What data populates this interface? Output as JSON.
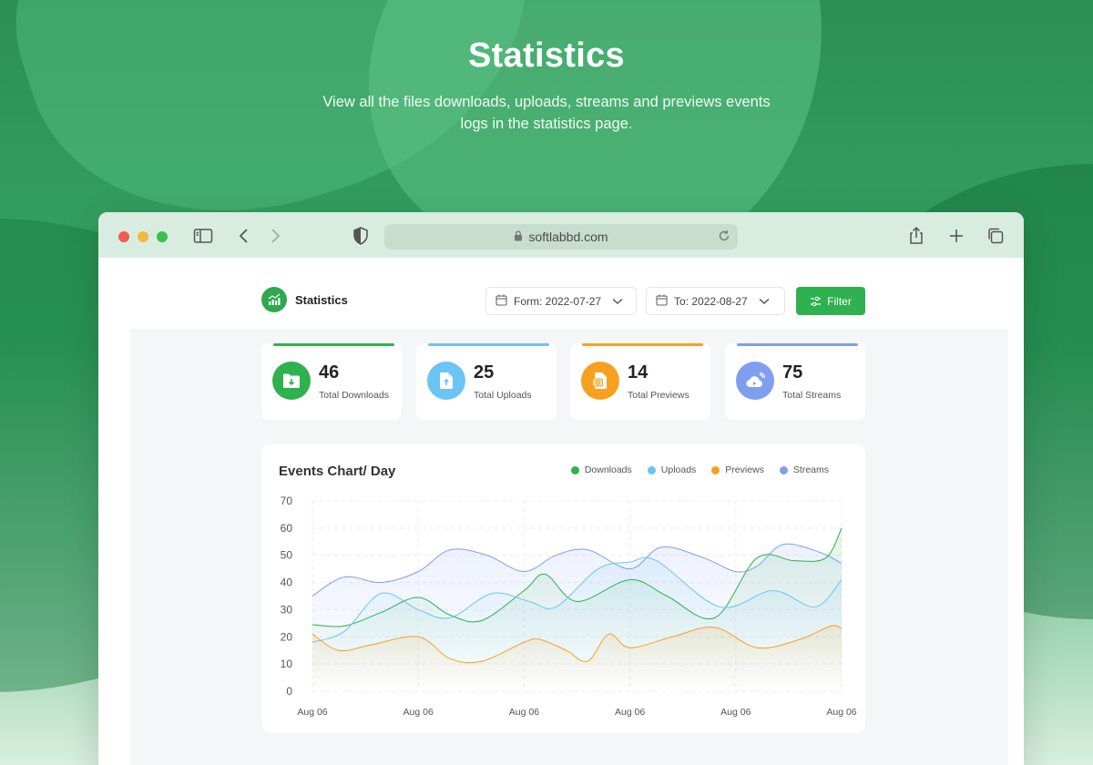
{
  "hero": {
    "title": "Statistics",
    "subtitle": "View all the files downloads, uploads, streams and previews events logs in the statistics page."
  },
  "browser": {
    "url": "softlabbd.com"
  },
  "header": {
    "title": "Statistics",
    "from_date": "Form: 2022-07-27",
    "to_date": "To: 2022-08-27",
    "filter_label": "Filter"
  },
  "stats": [
    {
      "value": "46",
      "label": "Total Downloads",
      "color": "#2fb14f",
      "icon": "folder-download-icon"
    },
    {
      "value": "25",
      "label": "Total Uploads",
      "color": "#6cc3f5",
      "icon": "file-upload-icon"
    },
    {
      "value": "14",
      "label": "Total Previews",
      "color": "#f5a11f",
      "icon": "file-preview-icon"
    },
    {
      "value": "75",
      "label": "Total Streams",
      "color": "#7f9ef0",
      "icon": "cloud-stream-icon"
    }
  ],
  "chart_data": {
    "type": "area",
    "title": "Events Chart/ Day",
    "x": [
      "Aug 06",
      "Aug 06",
      "Aug 06",
      "Aug 06",
      "Aug 06",
      "Aug 06"
    ],
    "ylim": [
      0,
      70
    ],
    "yticks": [
      0,
      10,
      20,
      30,
      40,
      50,
      60,
      70
    ],
    "grid": true,
    "legend": "top-right",
    "series": [
      {
        "name": "Downloads",
        "color": "#2fb14f",
        "points": [
          [
            0,
            24.5
          ],
          [
            0.3,
            24
          ],
          [
            0.65,
            29
          ],
          [
            1,
            34.5
          ],
          [
            1.3,
            28
          ],
          [
            1.6,
            26
          ],
          [
            2,
            37
          ],
          [
            2.2,
            43
          ],
          [
            2.5,
            33
          ],
          [
            3,
            41
          ],
          [
            3.35,
            35
          ],
          [
            3.8,
            27
          ],
          [
            4.2,
            49
          ],
          [
            4.55,
            48
          ],
          [
            4.85,
            49
          ],
          [
            5,
            60
          ]
        ]
      },
      {
        "name": "Uploads",
        "color": "#6cc3f5",
        "points": [
          [
            0,
            18
          ],
          [
            0.3,
            22
          ],
          [
            0.65,
            36
          ],
          [
            1,
            30
          ],
          [
            1.3,
            27
          ],
          [
            1.7,
            36
          ],
          [
            2.05,
            33
          ],
          [
            2.3,
            31
          ],
          [
            2.7,
            45
          ],
          [
            3,
            47.5
          ],
          [
            3.25,
            48
          ],
          [
            3.85,
            31
          ],
          [
            4.35,
            37
          ],
          [
            4.75,
            31
          ],
          [
            5,
            41
          ]
        ]
      },
      {
        "name": "Previews",
        "color": "#f5a11f",
        "points": [
          [
            0,
            21
          ],
          [
            0.25,
            15
          ],
          [
            0.55,
            17
          ],
          [
            1,
            20
          ],
          [
            1.3,
            12
          ],
          [
            1.6,
            11
          ],
          [
            2,
            18
          ],
          [
            2.15,
            19
          ],
          [
            2.4,
            15
          ],
          [
            2.6,
            11
          ],
          [
            2.8,
            21
          ],
          [
            3,
            16
          ],
          [
            3.4,
            20
          ],
          [
            3.8,
            23.5
          ],
          [
            4.2,
            16
          ],
          [
            4.6,
            19
          ],
          [
            4.9,
            24
          ],
          [
            5,
            23
          ]
        ]
      },
      {
        "name": "Streams",
        "color": "#7f9ef0",
        "points": [
          [
            0,
            35
          ],
          [
            0.3,
            42
          ],
          [
            0.65,
            40
          ],
          [
            1,
            44
          ],
          [
            1.3,
            52
          ],
          [
            1.65,
            50
          ],
          [
            2,
            44
          ],
          [
            2.3,
            50
          ],
          [
            2.6,
            52
          ],
          [
            3,
            45
          ],
          [
            3.3,
            53
          ],
          [
            3.7,
            49
          ],
          [
            4,
            44
          ],
          [
            4.2,
            46
          ],
          [
            4.45,
            54
          ],
          [
            4.8,
            51
          ],
          [
            5,
            47
          ]
        ]
      }
    ]
  }
}
